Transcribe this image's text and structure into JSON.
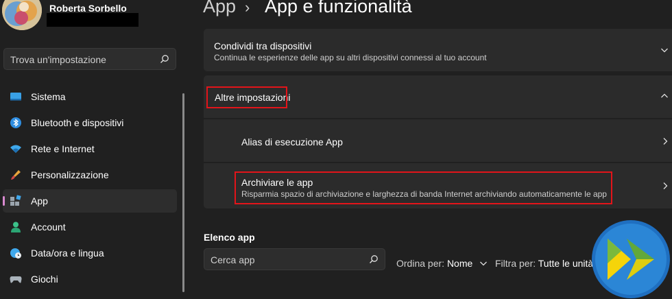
{
  "user": {
    "name": "Roberta Sorbello"
  },
  "sidebar": {
    "search_placeholder": "Trova un'impostazione",
    "items": [
      {
        "label": "Sistema",
        "icon": "monitor-icon"
      },
      {
        "label": "Bluetooth e dispositivi",
        "icon": "bluetooth-icon"
      },
      {
        "label": "Rete e Internet",
        "icon": "wifi-icon"
      },
      {
        "label": "Personalizzazione",
        "icon": "brush-icon"
      },
      {
        "label": "App",
        "icon": "apps-icon",
        "active": true
      },
      {
        "label": "Account",
        "icon": "person-icon"
      },
      {
        "label": "Data/ora e lingua",
        "icon": "globe-clock-icon"
      },
      {
        "label": "Giochi",
        "icon": "gamepad-icon"
      }
    ]
  },
  "breadcrumb": {
    "parent": "App",
    "separator": "›",
    "current": "App e funzionalità"
  },
  "cards": {
    "share": {
      "title": "Condividi tra dispositivi",
      "subtitle": "Continua le esperienze delle app su altri dispositivi connessi al tuo account"
    },
    "other": {
      "title": "Altre impostazioni"
    },
    "alias": {
      "title": "Alias di esecuzione App"
    },
    "archive": {
      "title": "Archiviare le app",
      "subtitle": "Risparmia spazio di archiviazione e larghezza di banda Internet archiviando automaticamente le app"
    }
  },
  "app_list": {
    "title": "Elenco app",
    "search_placeholder": "Cerca app",
    "sort_label": "Ordina per:",
    "sort_value": "Nome",
    "filter_label": "Filtra per:",
    "filter_value": "Tutte le unità"
  },
  "colors": {
    "background": "#202020",
    "card": "#2b2b2b",
    "highlight": "#e3141a",
    "accent_selection": "#d98ad0"
  }
}
